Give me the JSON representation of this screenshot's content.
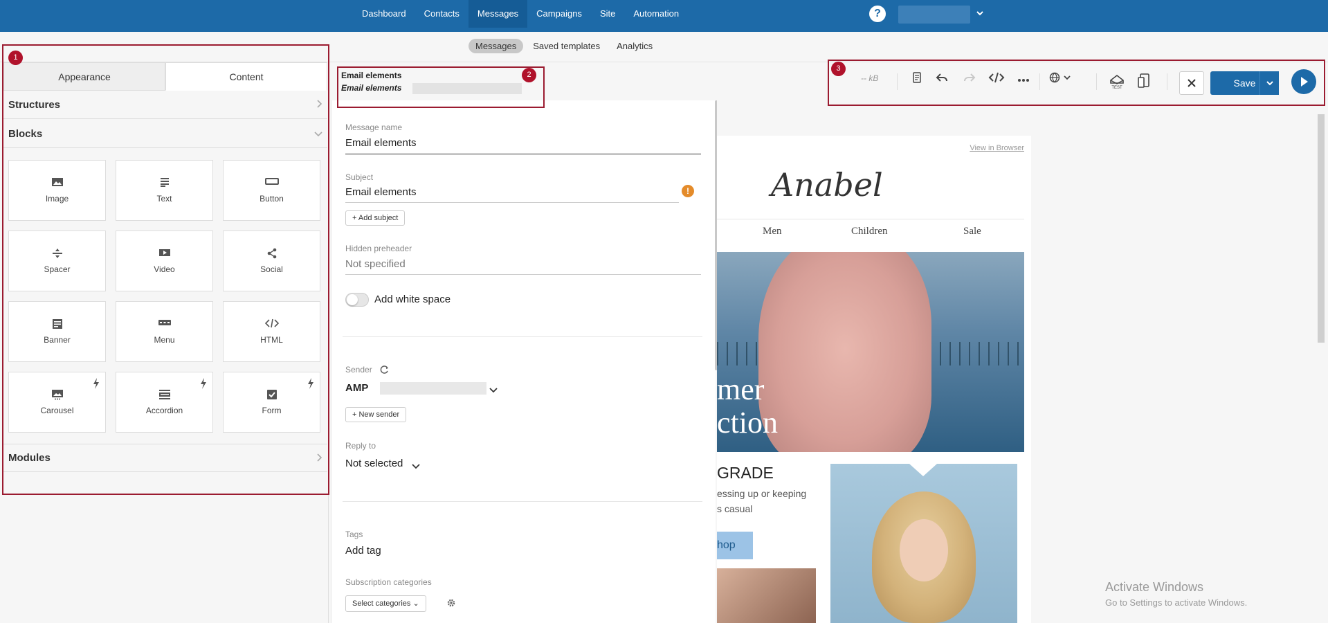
{
  "topnav": {
    "items": [
      "Dashboard",
      "Contacts",
      "Messages",
      "Campaigns",
      "Site",
      "Automation"
    ],
    "active": "Messages",
    "help_icon": "question-circle-icon"
  },
  "subnav": {
    "items": [
      "Messages",
      "Saved templates",
      "Analytics"
    ],
    "active": "Messages"
  },
  "left_panel": {
    "tabs": [
      "Appearance",
      "Content"
    ],
    "active_tab": "Content",
    "structures": "Structures",
    "blocks": "Blocks",
    "modules": "Modules",
    "block_items": [
      {
        "label": "Image",
        "icon": "image-icon",
        "bolt": false
      },
      {
        "label": "Text",
        "icon": "text-icon",
        "bolt": false
      },
      {
        "label": "Button",
        "icon": "button-icon",
        "bolt": false
      },
      {
        "label": "Spacer",
        "icon": "spacer-icon",
        "bolt": false
      },
      {
        "label": "Video",
        "icon": "video-icon",
        "bolt": false
      },
      {
        "label": "Social",
        "icon": "share-icon",
        "bolt": false
      },
      {
        "label": "Banner",
        "icon": "banner-icon",
        "bolt": false
      },
      {
        "label": "Menu",
        "icon": "menu-icon",
        "bolt": false
      },
      {
        "label": "HTML",
        "icon": "code-icon",
        "bolt": false
      },
      {
        "label": "Carousel",
        "icon": "carousel-icon",
        "bolt": true
      },
      {
        "label": "Accordion",
        "icon": "accordion-icon",
        "bolt": true
      },
      {
        "label": "Form",
        "icon": "form-checkbox-icon",
        "bolt": true
      }
    ]
  },
  "mid_panel": {
    "title": "Email elements",
    "breadcrumb": "Email elements",
    "message_name_label": "Message name",
    "message_name_value": "Email elements",
    "subject_label": "Subject",
    "subject_value": "Email elements",
    "add_subject": "Add subject",
    "preheader_label": "Hidden preheader",
    "preheader_value": "Not specified",
    "white_space_label": "Add white space",
    "sender_label": "Sender",
    "sender_value": "AMP",
    "new_sender": "New sender",
    "reply_to_label": "Reply to",
    "reply_to_value": "Not selected",
    "tags_label": "Tags",
    "tags_value": "Add tag",
    "subscription_label": "Subscription categories",
    "select_categories": "Select categories"
  },
  "toolbar": {
    "size": "-- kB",
    "save": "Save"
  },
  "email_preview": {
    "view_in_browser": "View in Browser",
    "logo": "Anabel",
    "nav": [
      "Men",
      "Children",
      "Sale"
    ],
    "hero_line1": "mer",
    "hero_line2": "ction",
    "headline": "GRADE",
    "desc_line1": "essing up or keeping",
    "desc_line2": "s casual",
    "shop": "hop"
  },
  "annotations": [
    "1",
    "2",
    "3"
  ],
  "watermark": {
    "line1": "Activate Windows",
    "line2": "Go to Settings to activate Windows."
  }
}
